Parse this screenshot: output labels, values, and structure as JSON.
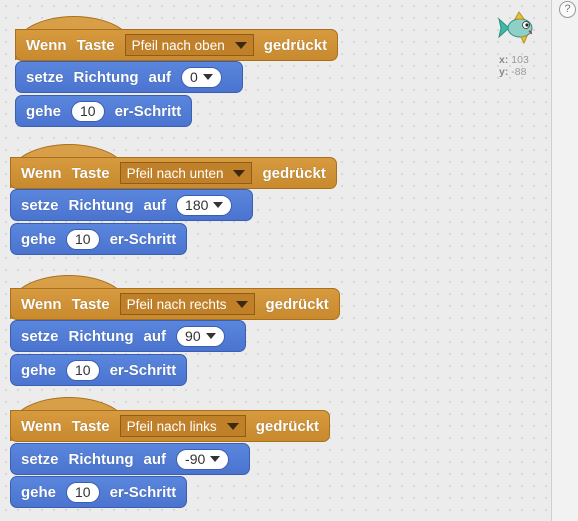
{
  "help": {
    "label": "?"
  },
  "sprite": {
    "icon": "fish-sprite-icon",
    "x_label": "x:",
    "x_value": "103",
    "y_label": "y:",
    "y_value": "-88"
  },
  "colors": {
    "event_block": "#d08f35",
    "motion_block": "#4f7cd4",
    "workspace": "#ececec"
  },
  "scripts": [
    {
      "hat": {
        "word1": "Wenn",
        "word2": "Taste",
        "key": "Pfeil nach oben",
        "word3": "gedrückt"
      },
      "turn": {
        "word1": "setze",
        "word2": "Richtung",
        "word3": "auf",
        "value": "0"
      },
      "move": {
        "word1": "gehe",
        "steps": "10",
        "word2": "er-Schritt"
      }
    },
    {
      "hat": {
        "word1": "Wenn",
        "word2": "Taste",
        "key": "Pfeil nach unten",
        "word3": "gedrückt"
      },
      "turn": {
        "word1": "setze",
        "word2": "Richtung",
        "word3": "auf",
        "value": "180"
      },
      "move": {
        "word1": "gehe",
        "steps": "10",
        "word2": "er-Schritt"
      }
    },
    {
      "hat": {
        "word1": "Wenn",
        "word2": "Taste",
        "key": "Pfeil nach rechts",
        "word3": "gedrückt"
      },
      "turn": {
        "word1": "setze",
        "word2": "Richtung",
        "word3": "auf",
        "value": "90"
      },
      "move": {
        "word1": "gehe",
        "steps": "10",
        "word2": "er-Schritt"
      }
    },
    {
      "hat": {
        "word1": "Wenn",
        "word2": "Taste",
        "key": "Pfeil nach links",
        "word3": "gedrückt"
      },
      "turn": {
        "word1": "setze",
        "word2": "Richtung",
        "word3": "auf",
        "value": "-90"
      },
      "move": {
        "word1": "gehe",
        "steps": "10",
        "word2": "er-Schritt"
      }
    }
  ]
}
